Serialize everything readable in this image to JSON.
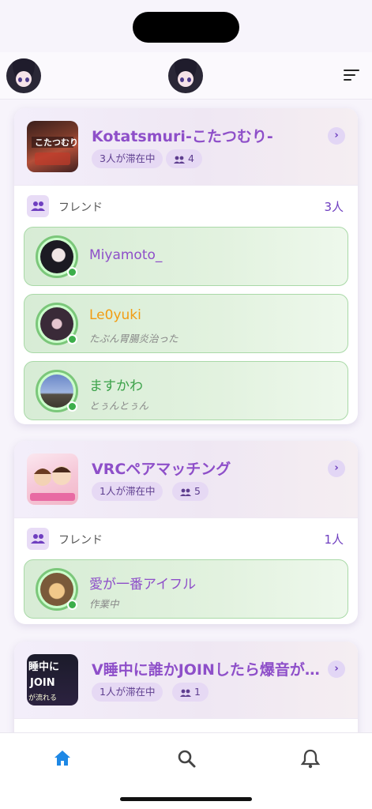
{
  "colors": {
    "accent": "#8e4fc9",
    "online": "#3cae4a",
    "tab_active": "#1e88e5"
  },
  "header": {
    "left_avatar": "user-avatar",
    "center_avatar": "user-avatar",
    "menu_icon": "sort-menu-icon"
  },
  "instances": [
    {
      "world_name": "Kotatsmuri-こたつむり-",
      "staying": "3人が滞在中",
      "user_count": "4",
      "friends_label": "フレンド",
      "friends_count": "3人",
      "friends": [
        {
          "name": "Miyamoto_",
          "status": "",
          "name_color": "#8e4fc9"
        },
        {
          "name": "Le0yuki",
          "status": "たぶん胃腸炎治った",
          "name_color": "#f29c11"
        },
        {
          "name": "ますかわ",
          "status": "とぅんとぅん",
          "name_color": "#3ca24a"
        }
      ]
    },
    {
      "world_name": "VRCペアマッチング",
      "staying": "1人が滞在中",
      "user_count": "5",
      "friends_label": "フレンド",
      "friends_count": "1人",
      "friends": [
        {
          "name": "愛が一番アイフル",
          "status": "作業中",
          "name_color": "#8e4fc9"
        }
      ]
    },
    {
      "world_name": "V睡中に誰かJOINしたら爆音が…",
      "staying": "1人が滞在中",
      "user_count": "1"
    }
  ],
  "tabs": [
    {
      "icon": "home-icon",
      "active": true
    },
    {
      "icon": "search-icon",
      "active": false
    },
    {
      "icon": "bell-icon",
      "active": false
    }
  ]
}
